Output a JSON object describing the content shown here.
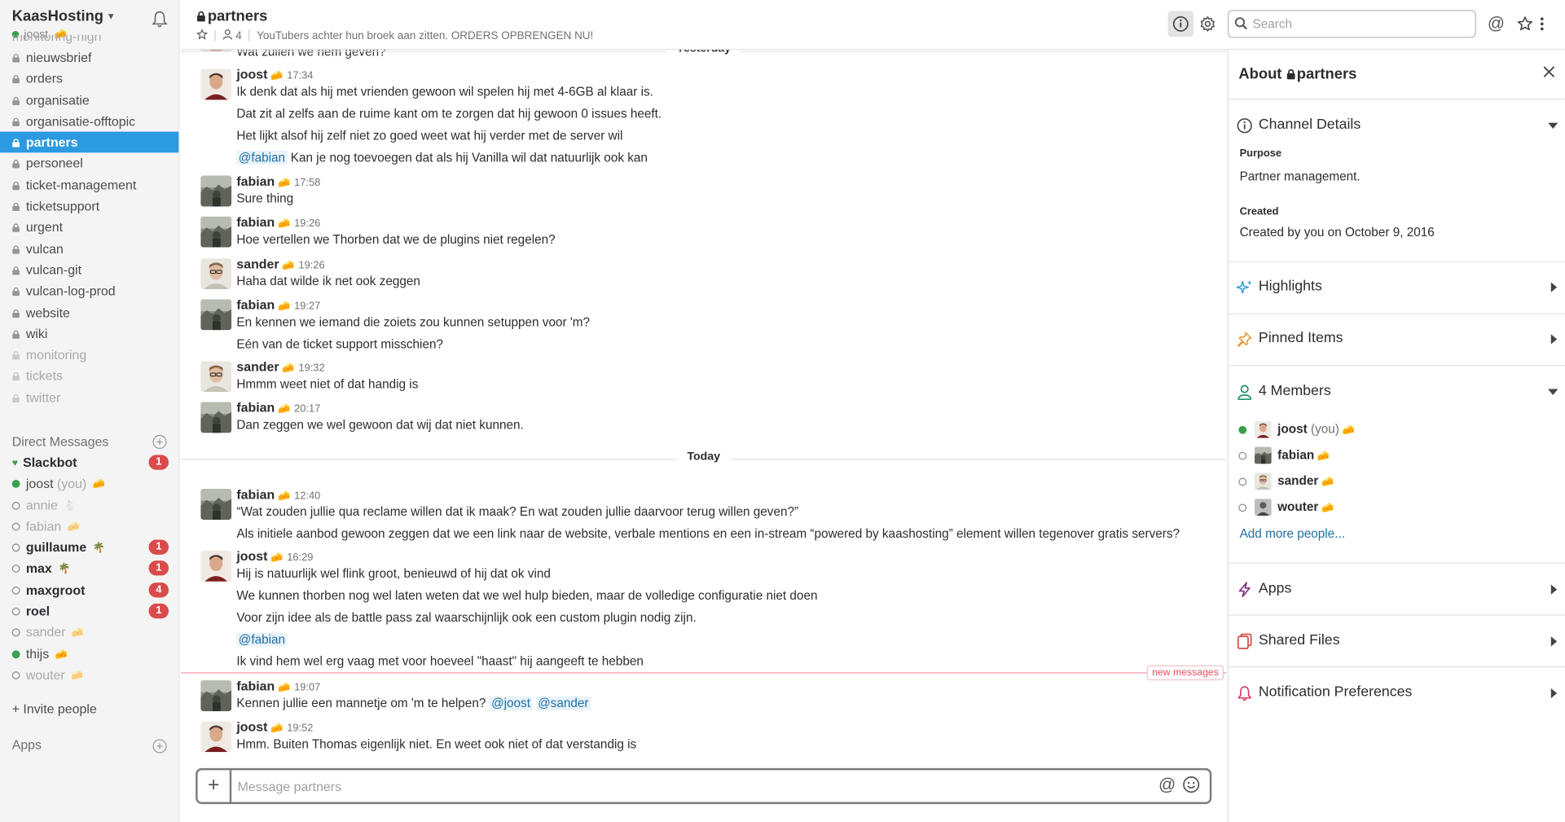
{
  "team": {
    "name": "KaasHosting",
    "user": "joost"
  },
  "sidebar": {
    "cut_channel": "monitoring-high",
    "channels": [
      {
        "name": "nieuwsbrief",
        "state": "normal"
      },
      {
        "name": "orders",
        "state": "normal"
      },
      {
        "name": "organisatie",
        "state": "normal"
      },
      {
        "name": "organisatie-offtopic",
        "state": "normal"
      },
      {
        "name": "partners",
        "state": "active"
      },
      {
        "name": "personeel",
        "state": "normal"
      },
      {
        "name": "ticket-management",
        "state": "normal"
      },
      {
        "name": "ticketsupport",
        "state": "normal"
      },
      {
        "name": "urgent",
        "state": "normal"
      },
      {
        "name": "vulcan",
        "state": "normal"
      },
      {
        "name": "vulcan-git",
        "state": "normal"
      },
      {
        "name": "vulcan-log-prod",
        "state": "normal"
      },
      {
        "name": "website",
        "state": "normal"
      },
      {
        "name": "wiki",
        "state": "normal"
      },
      {
        "name": "monitoring",
        "state": "dim"
      },
      {
        "name": "tickets",
        "state": "dim"
      },
      {
        "name": "twitter",
        "state": "dim"
      }
    ],
    "dm_title": "Direct Messages",
    "dms": [
      {
        "name": "Slackbot",
        "presence": "heart",
        "style": "bold",
        "badge": "1"
      },
      {
        "name": "joost",
        "suffix": "(you)",
        "presence": "on",
        "style": "normal",
        "emoji": "🧀"
      },
      {
        "name": "annie",
        "presence": "off",
        "style": "dim",
        "emoji": "🐇"
      },
      {
        "name": "fabian",
        "presence": "off",
        "style": "dim",
        "emoji": "🧀"
      },
      {
        "name": "guillaume",
        "presence": "off",
        "style": "bold",
        "emoji": "🌴",
        "badge": "1"
      },
      {
        "name": "max",
        "presence": "off",
        "style": "bold",
        "emoji": "🌴",
        "badge": "1"
      },
      {
        "name": "maxgroot",
        "presence": "off",
        "style": "bold",
        "badge": "4"
      },
      {
        "name": "roel",
        "presence": "off",
        "style": "bold",
        "badge": "1"
      },
      {
        "name": "sander",
        "presence": "off",
        "style": "dim",
        "emoji": "🧀"
      },
      {
        "name": "thijs",
        "presence": "on",
        "style": "normal",
        "emoji": "🧀"
      },
      {
        "name": "wouter",
        "presence": "off",
        "style": "dim",
        "emoji": "🧀"
      }
    ],
    "invite": "+ Invite people",
    "apps": "Apps"
  },
  "header": {
    "channel": "partners",
    "member_count": "4",
    "topic": "YouTubers achter hun broek aan zitten. ORDERS OPBRENGEN NU!",
    "search_placeholder": "Search"
  },
  "messages": {
    "partial_top": "Wat zullen we nem geven?",
    "day_yesterday": "Yesterday",
    "day_today": "Today",
    "new_messages": "new messages",
    "emoji": "🧀",
    "groups": [
      {
        "author": "joost",
        "time": "17:34",
        "lines": [
          "Ik denk dat als hij met vrienden gewoon wil spelen hij met 4-6GB al klaar is.",
          "Dat zit al zelfs aan de ruime kant om te zorgen dat hij gewoon 0 issues heeft.",
          "Het lijkt alsof hij zelf niet zo goed weet wat hij verder met de server wil",
          "Kan je nog toevoegen dat als hij Vanilla wil dat natuurlijk ook kan"
        ],
        "mention4": "@fabian"
      },
      {
        "author": "fabian",
        "time": "17:58",
        "lines": [
          "Sure thing"
        ]
      },
      {
        "author": "fabian",
        "time": "19:26",
        "lines": [
          "Hoe vertellen we Thorben dat we de plugins niet regelen?"
        ]
      },
      {
        "author": "sander",
        "time": "19:26",
        "lines": [
          "Haha dat wilde ik net ook zeggen"
        ]
      },
      {
        "author": "fabian",
        "time": "19:27",
        "lines": [
          "En kennen we iemand die zoiets zou kunnen setuppen voor 'm?",
          "Eén van de ticket support misschien?"
        ]
      },
      {
        "author": "sander",
        "time": "19:32",
        "lines": [
          "Hmmm weet niet of dat handig is"
        ]
      },
      {
        "author": "fabian",
        "time": "20:17",
        "lines": [
          "Dan zeggen we wel gewoon dat wij dat niet kunnen."
        ]
      },
      {
        "author": "fabian",
        "time": "12:40",
        "lines": [
          "“Wat zouden jullie qua reclame willen dat ik maak? En wat zouden jullie daarvoor terug willen geven?”",
          "Als initiele aanbod gewoon zeggen dat we een link naar de website, verbale mentions en een in-stream “powered by kaashosting” element willen tegenover gratis servers?"
        ]
      },
      {
        "author": "joost",
        "time": "16:29",
        "lines": [
          "Hij is natuurlijk wel flink groot, benieuwd of hij dat ok vind",
          "We kunnen thorben nog wel laten weten dat we wel hulp bieden, maar de volledige configuratie niet doen",
          "Voor zijn idee als de battle pass zal waarschijnlijk ook een custom plugin nodig zijn.",
          "@fabian",
          "Ik vind hem wel erg vaag met voor hoeveel \"haast\" hij aangeeft te hebben"
        ]
      },
      {
        "author": "fabian",
        "time": "19:07",
        "lines": [
          "Kennen jullie een mannetje om 'm te helpen?"
        ],
        "mentions": [
          "@joost",
          "@sander"
        ]
      },
      {
        "author": "joost",
        "time": "19:52",
        "lines": [
          "Hmm. Buiten Thomas eigenlijk niet. En weet ook niet of dat verstandig is"
        ]
      }
    ]
  },
  "composer": {
    "placeholder": "Message partners"
  },
  "panel": {
    "title": "About",
    "channel": "partners",
    "channel_details": "Channel Details",
    "purpose_label": "Purpose",
    "purpose": "Partner management.",
    "created_label": "Created",
    "created": "Created by you on October 9, 2016",
    "highlights": "Highlights",
    "pinned": "Pinned Items",
    "members_title": "4 Members",
    "members": [
      {
        "name": "joost",
        "suffix": "(you)",
        "presence": "on"
      },
      {
        "name": "fabian",
        "presence": "off"
      },
      {
        "name": "sander",
        "presence": "off"
      },
      {
        "name": "wouter",
        "presence": "off"
      }
    ],
    "add_more": "Add more people...",
    "apps": "Apps",
    "shared_files": "Shared Files",
    "notification_prefs": "Notification Preferences"
  },
  "colors": {
    "accent": "#2b9ae0",
    "badge": "#d94b4b",
    "presence": "#39a04d",
    "new_messages": "#eb4d5c",
    "link": "#1d6fa5"
  }
}
